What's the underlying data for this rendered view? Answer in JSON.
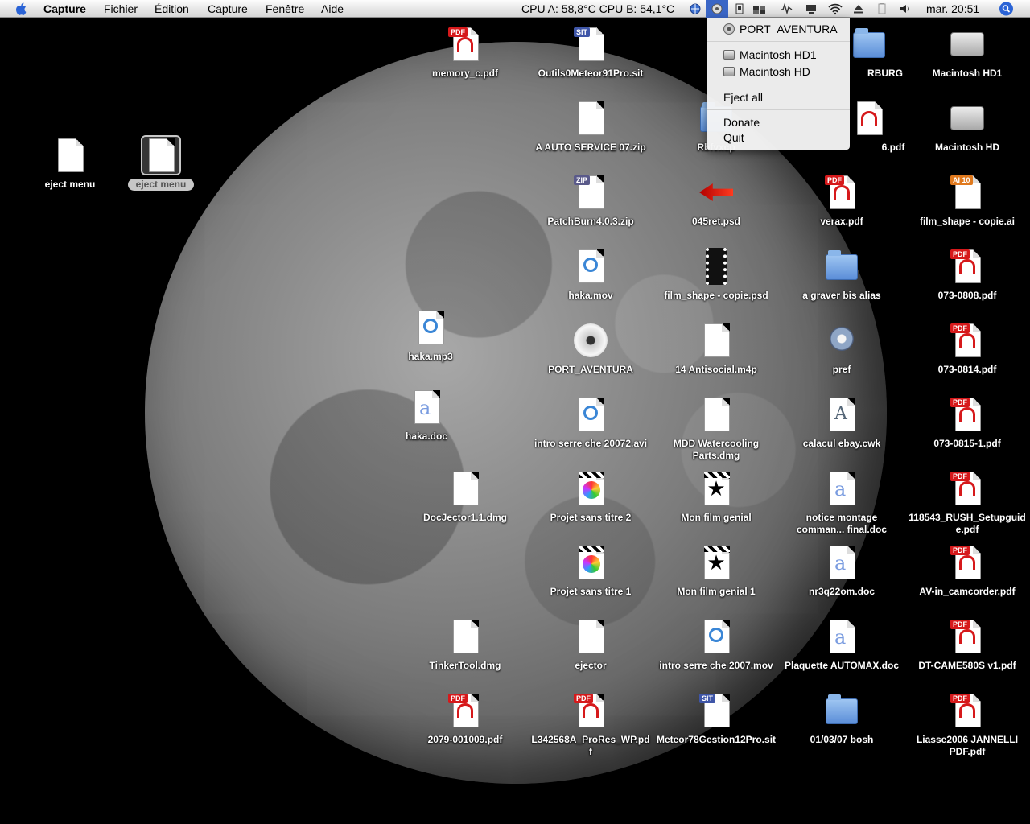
{
  "menubar": {
    "app_name": "Capture",
    "menus": [
      "Fichier",
      "Édition",
      "Capture",
      "Fenêtre",
      "Aide"
    ],
    "cpu_text": "CPU A: 58,8°C CPU B: 54,1°C",
    "clock": "mar. 20:51"
  },
  "dropdown": {
    "items": [
      {
        "label": "PORT_AVENTURA",
        "icon": "dvd-icon"
      },
      {
        "label": "Macintosh HD1",
        "icon": "hard-disk-icon"
      },
      {
        "label": "Macintosh HD",
        "icon": "hard-disk-icon"
      },
      {
        "label": "Eject all"
      },
      {
        "label": "Donate"
      },
      {
        "label": "Quit"
      }
    ]
  },
  "desktop": {
    "icons": [
      {
        "label": "eject menu",
        "type": "tiff"
      },
      {
        "label": "eject menu",
        "type": "jpeg"
      },
      {
        "label": "memory_c.pdf",
        "type": "pdf"
      },
      {
        "label": "Outils0Meteor91Pro.sit",
        "type": "sit"
      },
      {
        "label": "A AUTO SERVICE 07.zip",
        "type": "zip"
      },
      {
        "label": "Rbfvxcp",
        "type": "folder"
      },
      {
        "label": "PatchBurn4.0.3.zip",
        "type": "zip"
      },
      {
        "label": "045ret.psd",
        "type": "psd"
      },
      {
        "label": "haka.mov",
        "type": "mov"
      },
      {
        "label": "film_shape - copie.psd",
        "type": "film"
      },
      {
        "label": "haka.mp3",
        "type": "mp3"
      },
      {
        "label": "PORT_AVENTURA",
        "type": "dvd"
      },
      {
        "label": "14 Antisocial.m4p",
        "type": "m4p"
      },
      {
        "label": "haka.doc",
        "type": "doc"
      },
      {
        "label": "intro serre che 20072.avi",
        "type": "avi"
      },
      {
        "label": "MDD Watercooling Parts.dmg",
        "type": "dmg"
      },
      {
        "label": "DocJector1.1.dmg",
        "type": "dmg"
      },
      {
        "label": "Projet sans titre 2",
        "type": "imovie"
      },
      {
        "label": "Mon film genial",
        "type": "star"
      },
      {
        "label": "Projet sans titre 1",
        "type": "imovie"
      },
      {
        "label": "Mon film genial 1",
        "type": "star"
      },
      {
        "label": "TinkerTool.dmg",
        "type": "dmg"
      },
      {
        "label": "ejector",
        "type": "tiff"
      },
      {
        "label": "intro serre che 2007.mov",
        "type": "mov"
      },
      {
        "label": "2079-001009.pdf",
        "type": "pdf"
      },
      {
        "label": "L342568A_ProRes_WP.pdf",
        "type": "pdf"
      },
      {
        "label": "Meteor78Gestion12Pro.sit",
        "type": "sit"
      },
      {
        "label": "RBURG",
        "type": "folder"
      },
      {
        "label": "6.pdf",
        "type": "pdf"
      },
      {
        "label": "verax.pdf",
        "type": "pdf"
      },
      {
        "label": "a graver bis alias",
        "type": "folder"
      },
      {
        "label": "pref",
        "type": "pref"
      },
      {
        "label": "calacul ebay.cwk",
        "type": "cwk"
      },
      {
        "label": "notice montage comman... final.doc",
        "type": "doc"
      },
      {
        "label": "nr3q22om.doc",
        "type": "doc"
      },
      {
        "label": "Plaquette AUTOMAX.doc",
        "type": "doc"
      },
      {
        "label": "01/03/07 bosh",
        "type": "folder"
      },
      {
        "label": "Macintosh HD1",
        "type": "disk"
      },
      {
        "label": "Macintosh HD",
        "type": "disk"
      },
      {
        "label": "film_shape - copie.ai",
        "type": "ai"
      },
      {
        "label": "073-0808.pdf",
        "type": "pdf"
      },
      {
        "label": "073-0814.pdf",
        "type": "pdf"
      },
      {
        "label": "073-0815-1.pdf",
        "type": "pdf"
      },
      {
        "label": "118543_RUSH_Setupguide.pdf",
        "type": "pdf"
      },
      {
        "label": "AV-in_camcorder.pdf",
        "type": "pdf"
      },
      {
        "label": "DT-CAME580S v1.pdf",
        "type": "pdf"
      },
      {
        "label": "Liasse2006 JANNELLI PDF.pdf",
        "type": "pdf"
      }
    ]
  }
}
